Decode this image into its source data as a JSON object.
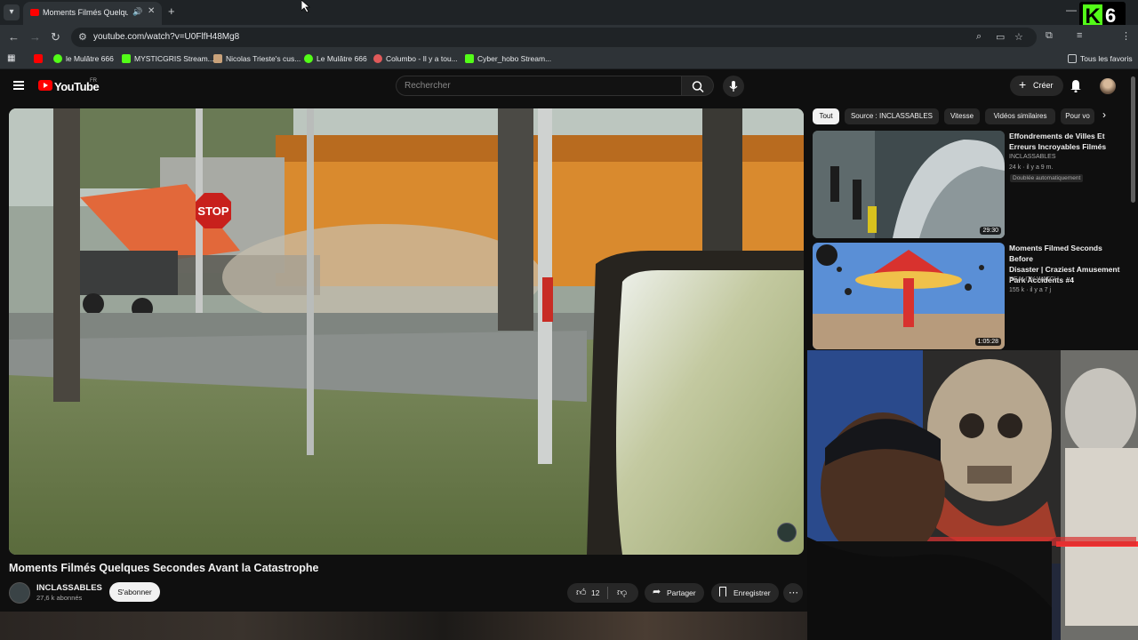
{
  "browser": {
    "tab_title": "Moments Filmés Quelques",
    "url": "youtube.com/watch?v=U0FlfH48Mg8",
    "bookmarks": [
      "le Mulâtre 666",
      "MYSTICGRIS Stream...",
      "Nicolas Trieste's cus...",
      "Le Mulâtre 666",
      "Columbo - Il y a tou...",
      "Cyber_hobo Stream..."
    ],
    "all_bookmarks": "Tous les favoris"
  },
  "overlay": {
    "kick_number": "6"
  },
  "youtube": {
    "logo_text": "YouTube",
    "region": "FR",
    "search_placeholder": "Rechercher",
    "create_label": "Créer"
  },
  "video": {
    "title": "Moments Filmés Quelques Secondes Avant la Catastrophe",
    "sign_text": "STOP",
    "channel": "INCLASSABLES",
    "subscribers": "27,6 k abonnés",
    "subscribe_label": "S'abonner",
    "likes": "12",
    "share_label": "Partager",
    "save_label": "Enregistrer"
  },
  "chips": [
    "Tout",
    "Source : INCLASSABLES",
    "Vitesse",
    "Vidéos similaires",
    "Pour vo"
  ],
  "recommendations": [
    {
      "title_line1": "Effondrements de Villes Et",
      "title_line2": "Erreurs Incroyables Filmés",
      "channel": "INCLASSABLES",
      "meta": "24 k · il y a 9 m.",
      "badge": "Doublée automatiquement",
      "duration": "29:30"
    },
    {
      "title_line1": "Moments Filmed Seconds Before",
      "title_line2": "Disaster | Craziest Amusement",
      "title_line3": "Park Accidents #4",
      "channel": "REALITY WATCH",
      "meta": "155 k · il y a 7 j",
      "duration": "1:05:28"
    }
  ]
}
